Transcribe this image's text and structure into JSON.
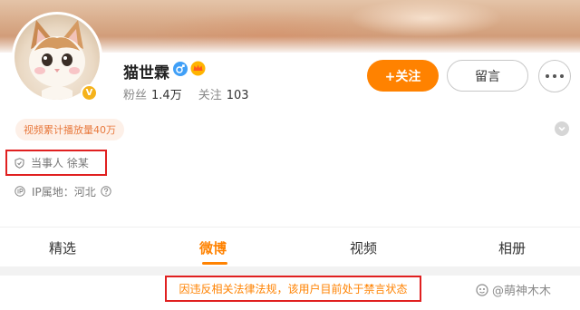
{
  "profile": {
    "name": "猫世霖",
    "fans_label": "粉丝",
    "fans_count": "1.4万",
    "following_label": "关注",
    "following_count": "103"
  },
  "actions": {
    "follow_label": "+关注",
    "message_label": "留言"
  },
  "info": {
    "views_tag": "视频累计播放量40万",
    "party_text": "当事人 徐某",
    "ip_text": "IP属地：河北"
  },
  "tabs": [
    {
      "label": "精选"
    },
    {
      "label": "微博"
    },
    {
      "label": "视频"
    },
    {
      "label": "相册"
    }
  ],
  "notice": {
    "ban_text": "因违反相关法律法规，该用户目前处于禁言状态"
  },
  "watermark": {
    "text": "@萌神木木"
  },
  "colors": {
    "accent": "#ff8200",
    "highlight_border": "#e02020",
    "verified_badge": "#f5b21b",
    "gender_male": "#3f9ff7"
  },
  "icons": [
    "verified-badge-icon",
    "male-icon",
    "vip-crown-icon",
    "more-dots-icon",
    "chevron-down-icon",
    "shield-icon",
    "ip-location-icon",
    "help-icon",
    "watermark-logo-icon"
  ]
}
